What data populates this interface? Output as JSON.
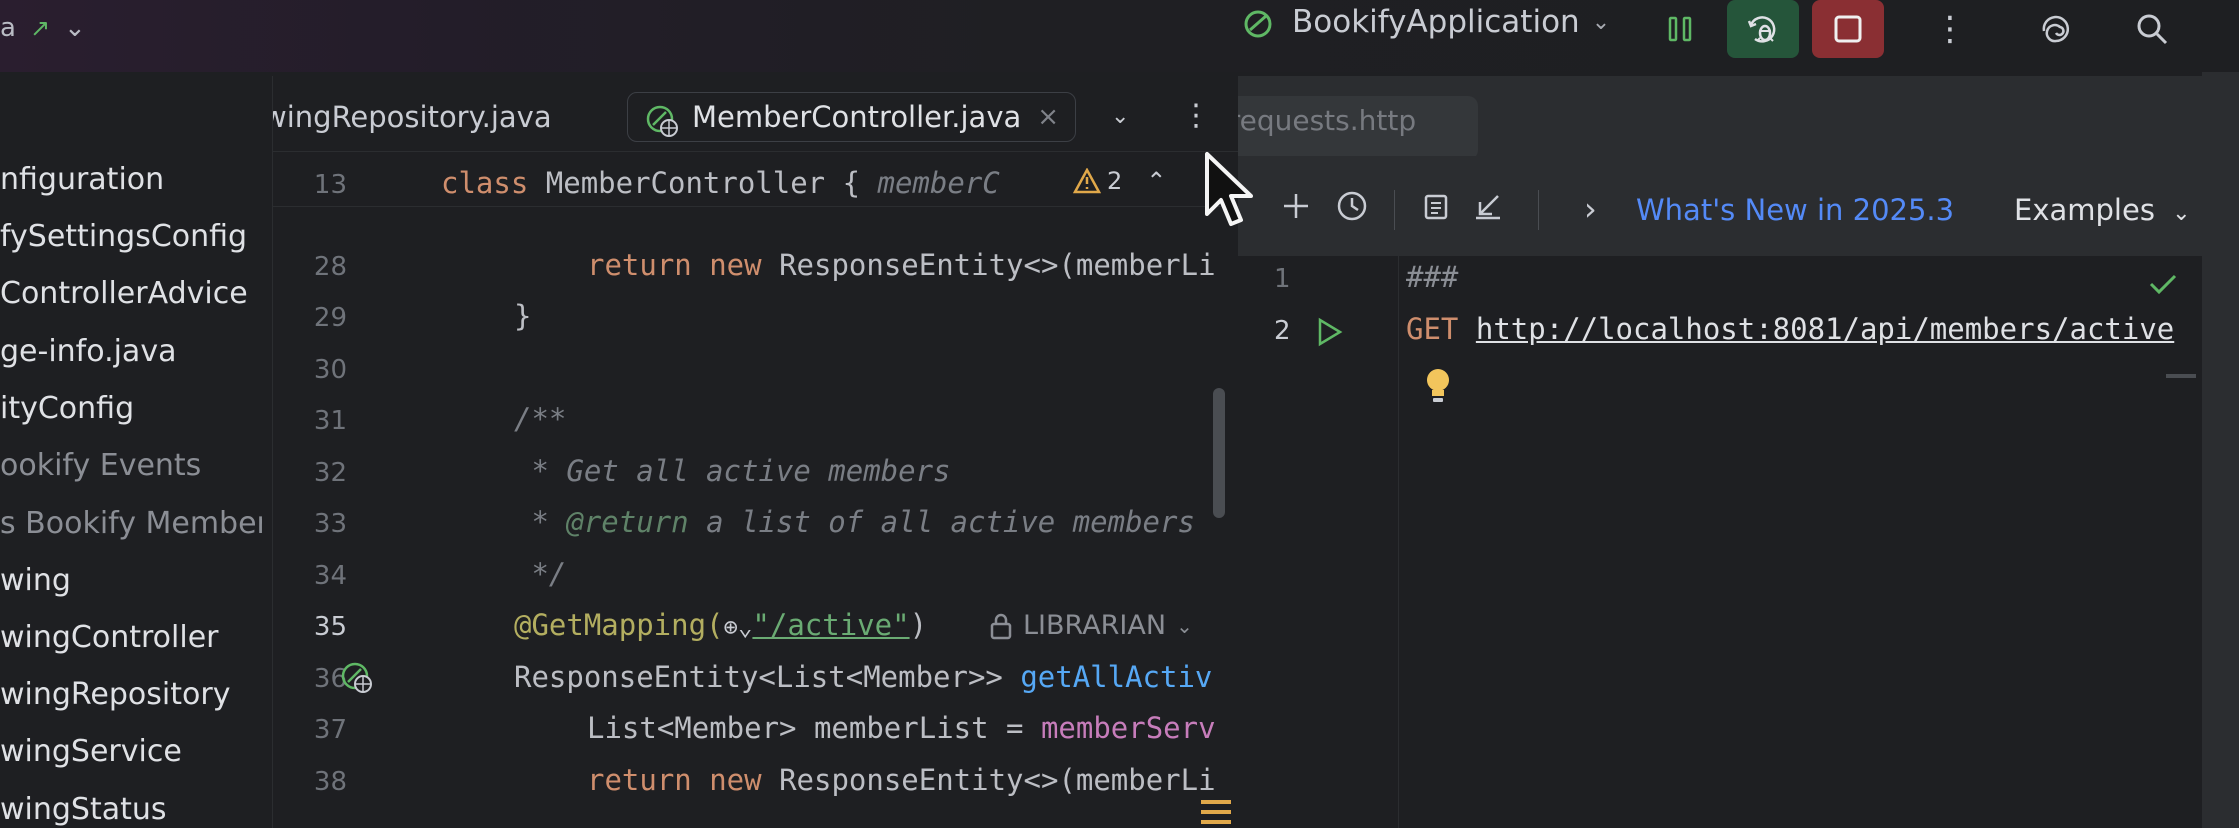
{
  "toolbar": {
    "project_chevron": "⌄",
    "run_config": "BookifyApplication",
    "more": "⋮"
  },
  "tree": {
    "items": [
      {
        "label": "nfiguration",
        "dim": false
      },
      {
        "label": "fySettingsConfig",
        "dim": false
      },
      {
        "label": "ControllerAdvice",
        "dim": false
      },
      {
        "label": "ge-info.java",
        "dim": false
      },
      {
        "label": "ityConfig",
        "dim": false
      },
      {
        "label": "ookify Events",
        "dim": true
      },
      {
        "label": "s Bookify Members",
        "dim": true
      },
      {
        "label": "wing",
        "dim": false
      },
      {
        "label": "wingController",
        "dim": false
      },
      {
        "label": "wingRepository",
        "dim": false
      },
      {
        "label": "wingService",
        "dim": false
      },
      {
        "label": "wingStatus",
        "dim": false
      }
    ]
  },
  "editor": {
    "tabs": {
      "inactive": "wingRepository.java",
      "active": "MemberController.java",
      "close": "×",
      "dropdown": "⌄",
      "more": "⋮"
    },
    "sticky": {
      "line": "13",
      "kw": "class",
      "text": " MemberController {",
      "hint": "memberC"
    },
    "warnings": {
      "count": "2",
      "up": "⌃",
      "down": "⌄"
    },
    "lines": [
      {
        "n": "28",
        "kw": "return new",
        "rest": " ResponseEntity<>(memberLi"
      },
      {
        "n": "29",
        "text": "}"
      },
      {
        "n": "30",
        "text": ""
      },
      {
        "n": "31",
        "comment": "/**"
      },
      {
        "n": "32",
        "comment": " * Get all active members"
      },
      {
        "n": "33",
        "tag": "@return",
        "comment_pre": " * ",
        "comment": " a list of all active members"
      },
      {
        "n": "34",
        "comment": " */"
      },
      {
        "n": "35",
        "ann": "@GetMapping(",
        "str": "\"/active\"",
        "close": ")",
        "role": "LIBRARIAN"
      },
      {
        "n": "36",
        "text": "ResponseEntity<List<Member>> ",
        "fn": "getAllActiv"
      },
      {
        "n": "37",
        "text": "List<Member> memberList = ",
        "fld": "memberServ"
      },
      {
        "n": "38",
        "kw": "return new",
        "rest": " ResponseEntity<>(memberLi"
      }
    ]
  },
  "http": {
    "ghost_tab": "generated-requests.http",
    "whats_new": "What's New in 2025.3",
    "examples": "Examples",
    "examples_chev": "⌄",
    "breadcrumb_chev": "›",
    "lines": [
      {
        "n": "1",
        "text": "###"
      },
      {
        "n": "2",
        "method": "GET",
        "url": "http://localhost:8081/api/members/active"
      }
    ]
  },
  "colors": {
    "debug_bg": "#25553a",
    "stop_bg": "#8a2f33",
    "link": "#548af7"
  },
  "icons": [
    "run-arrow-icon",
    "pause-icon",
    "debug-icon",
    "stop-icon",
    "ai-assistant-icon",
    "search-icon",
    "spring-controller-icon",
    "warning-icon",
    "plus-icon",
    "history-icon",
    "copy-icon",
    "import-icon",
    "run-request-icon",
    "lightbulb-icon",
    "check-icon",
    "globe-icon",
    "lock-icon",
    "mouse-cursor-icon"
  ]
}
